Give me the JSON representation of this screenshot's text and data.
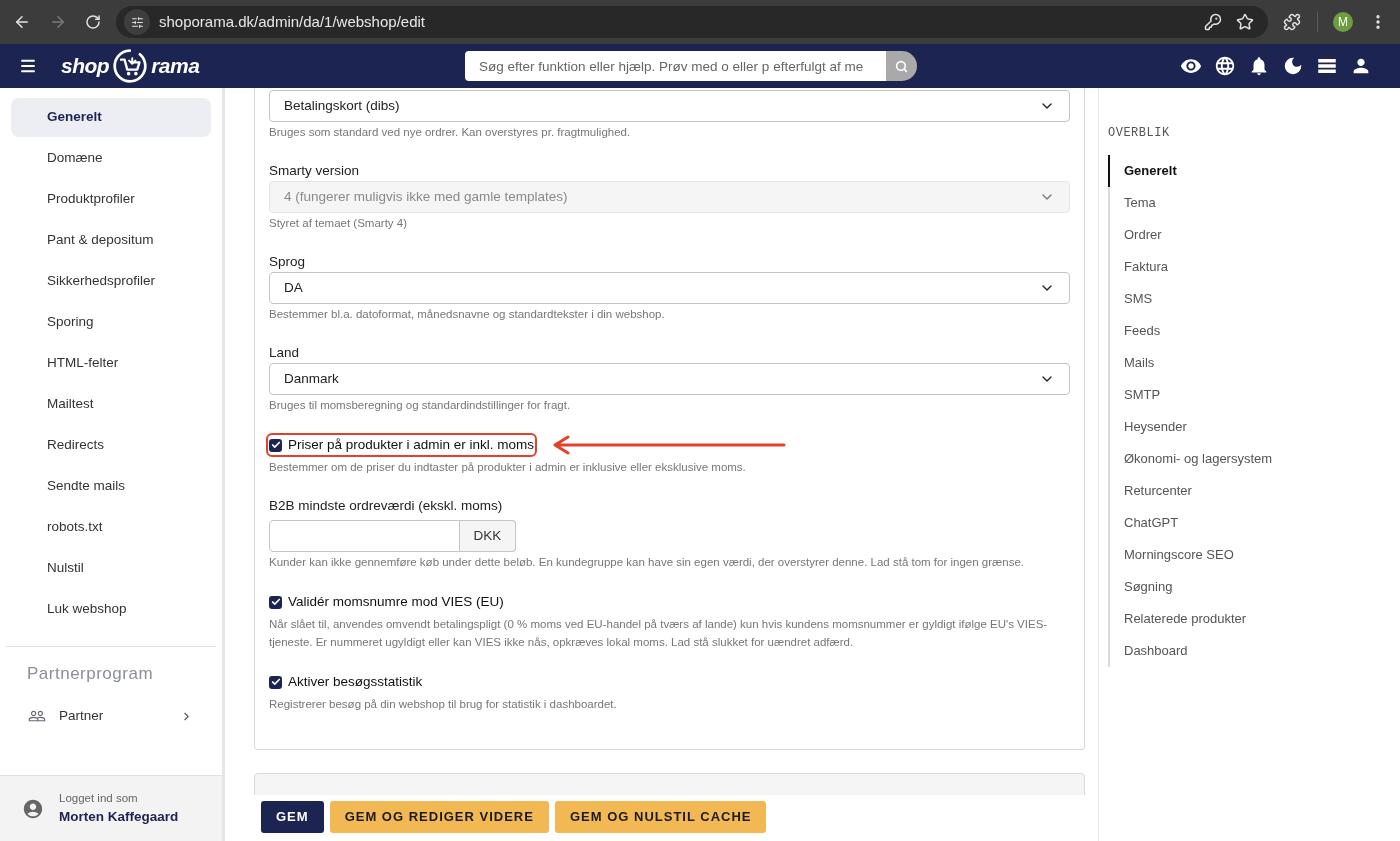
{
  "browser": {
    "url": "shoporama.dk/admin/da/1/webshop/edit",
    "forward_disabled": true,
    "profile_initial": "M"
  },
  "header": {
    "logo": {
      "left": "shop",
      "right": "rama"
    },
    "search": {
      "placeholder": "Søg efter funktion eller hjælp. Prøv med o eller p efterfulgt af me"
    }
  },
  "sidebar": {
    "items": [
      {
        "label": "Generelt",
        "selected": true
      },
      {
        "label": "Domæne",
        "selected": false
      },
      {
        "label": "Produktprofiler",
        "selected": false
      },
      {
        "label": "Pant & depositum",
        "selected": false
      },
      {
        "label": "Sikkerhedsprofiler",
        "selected": false
      },
      {
        "label": "Sporing",
        "selected": false
      },
      {
        "label": "HTML-felter",
        "selected": false
      },
      {
        "label": "Mailtest",
        "selected": false
      },
      {
        "label": "Redirects",
        "selected": false
      },
      {
        "label": "Sendte mails",
        "selected": false
      },
      {
        "label": "robots.txt",
        "selected": false
      },
      {
        "label": "Nulstil",
        "selected": false
      },
      {
        "label": "Luk webshop",
        "selected": false
      }
    ],
    "section_title": "Partnerprogram",
    "section_items": [
      {
        "label": "Partner"
      }
    ],
    "footer": {
      "caption": "Logget ind som",
      "user": "Morten Kaffegaard"
    }
  },
  "form": {
    "fields": [
      {
        "kind": "select",
        "value": "Betalingskort (dibs)",
        "disabled": false,
        "help": "Bruges som standard ved nye ordrer. Kan overstyres pr. fragtmulighed."
      },
      {
        "kind": "select",
        "label": "Smarty version",
        "value": "4 (fungerer muligvis ikke med gamle templates)",
        "disabled": true,
        "help": "Styret af temaet (Smarty 4)"
      },
      {
        "kind": "select",
        "label": "Sprog",
        "value": "DA",
        "disabled": false,
        "help": "Bestemmer bl.a. datoformat, månedsnavne og standardtekster i din webshop."
      },
      {
        "kind": "select",
        "label": "Land",
        "value": "Danmark",
        "disabled": false,
        "help": "Bruges til momsberegning og standardindstillinger for fragt."
      },
      {
        "kind": "checkbox",
        "label": "Priser på produkter i admin er inkl. moms",
        "checked": true,
        "highlighted": true,
        "help": "Bestemmer om de priser du indtaster på produkter i admin er inklusive eller eksklusive moms."
      },
      {
        "kind": "amount",
        "label": "B2B mindste ordreværdi (ekskl. moms)",
        "unit": "DKK",
        "help": "Kunder kan ikke gennemføre køb under dette beløb. En kundegruppe kan have sin egen værdi, der overstyrer denne. Lad stå tom for ingen grænse."
      },
      {
        "kind": "checkbox",
        "label": "Validér momsnumre mod VIES (EU)",
        "checked": true,
        "highlighted": false,
        "help": "Når slået til, anvendes omvendt betalingspligt (0 % moms ved EU-handel på tværs af lande) kun hvis kundens momsnummer er gyldigt ifølge EU's VIES-tjeneste. Er nummeret ugyldigt eller kan VIES ikke nås, opkræves lokal moms. Lad stå slukket for uændret adfærd."
      },
      {
        "kind": "checkbox",
        "label": "Aktiver besøgsstatistik",
        "checked": true,
        "highlighted": false,
        "help": "Registrerer besøg på din webshop til brug for statistik i dashboardet."
      }
    ]
  },
  "overview": {
    "title": "OVERBLIK",
    "items": [
      {
        "label": "Generelt",
        "selected": true
      },
      {
        "label": "Tema",
        "selected": false
      },
      {
        "label": "Ordrer",
        "selected": false
      },
      {
        "label": "Faktura",
        "selected": false
      },
      {
        "label": "SMS",
        "selected": false
      },
      {
        "label": "Feeds",
        "selected": false
      },
      {
        "label": "Mails",
        "selected": false
      },
      {
        "label": "SMTP",
        "selected": false
      },
      {
        "label": "Heysender",
        "selected": false
      },
      {
        "label": "Økonomi- og lagersystem",
        "selected": false
      },
      {
        "label": "Returcenter",
        "selected": false
      },
      {
        "label": "ChatGPT",
        "selected": false
      },
      {
        "label": "Morningscore SEO",
        "selected": false
      },
      {
        "label": "Søgning",
        "selected": false
      },
      {
        "label": "Relaterede produkter",
        "selected": false
      },
      {
        "label": "Dashboard",
        "selected": false
      }
    ]
  },
  "actions": [
    {
      "label": "GEM",
      "kind": "primary"
    },
    {
      "label": "GEM OG REDIGER VIDERE",
      "kind": "secondary"
    },
    {
      "label": "GEM OG NULSTIL CACHE",
      "kind": "secondary"
    }
  ]
}
